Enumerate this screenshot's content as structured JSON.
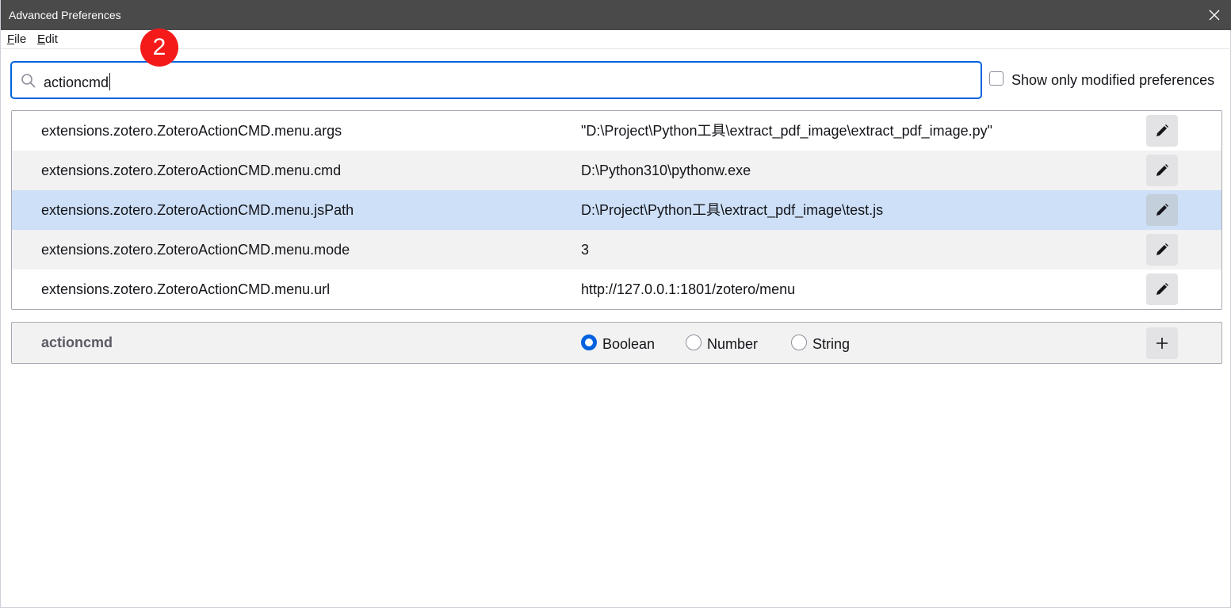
{
  "window": {
    "title": "Advanced Preferences"
  },
  "menubar": {
    "file_underline": "F",
    "file_rest": "ile",
    "edit_underline": "E",
    "edit_rest": "dit"
  },
  "annotation_badge": "2",
  "search": {
    "value": "actioncmd",
    "icon": "search-icon"
  },
  "modified_only": {
    "label": "Show only modified preferences",
    "checked": false
  },
  "preferences": [
    {
      "name": "extensions.zotero.ZoteroActionCMD.menu.args",
      "value": "\"D:\\Project\\Python工具\\extract_pdf_image\\extract_pdf_image.py\""
    },
    {
      "name": "extensions.zotero.ZoteroActionCMD.menu.cmd",
      "value": "D:\\Python310\\pythonw.exe"
    },
    {
      "name": "extensions.zotero.ZoteroActionCMD.menu.jsPath",
      "value": "D:\\Project\\Python工具\\extract_pdf_image\\test.js",
      "selected": true
    },
    {
      "name": "extensions.zotero.ZoteroActionCMD.menu.mode",
      "value": "3"
    },
    {
      "name": "extensions.zotero.ZoteroActionCMD.menu.url",
      "value": "http://127.0.0.1:1801/zotero/menu"
    }
  ],
  "new_pref": {
    "name": "actioncmd",
    "types": [
      "Boolean",
      "Number",
      "String"
    ],
    "selected_type": "Boolean"
  },
  "colors": {
    "titlebar": "#4a4a4a",
    "accent": "#0061e0",
    "selected_row": "#cde0f7",
    "badge": "#f51a1a"
  }
}
